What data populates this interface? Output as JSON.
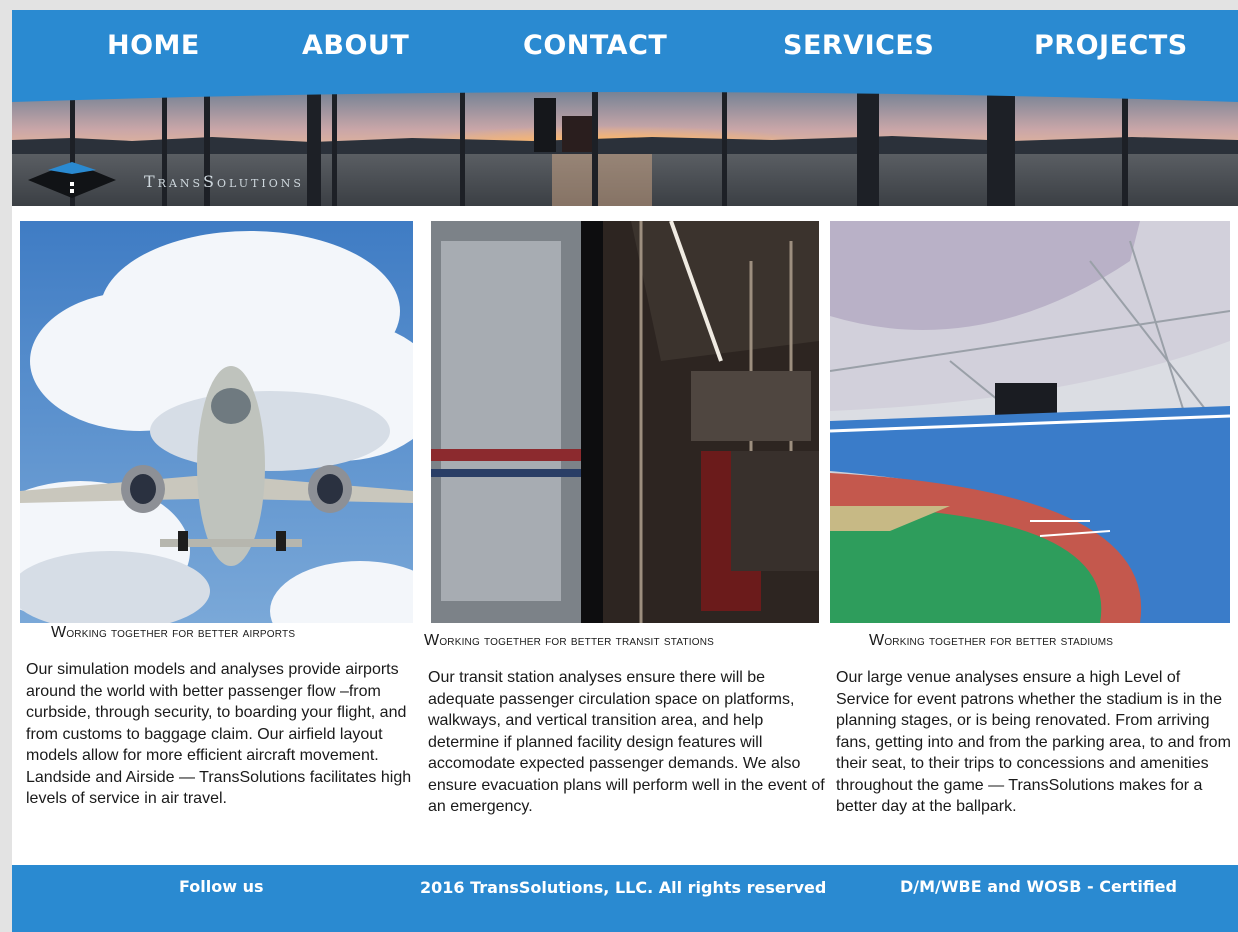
{
  "nav": {
    "items": [
      {
        "label": "HOME"
      },
      {
        "label": "ABOUT"
      },
      {
        "label": "CONTACT"
      },
      {
        "label": "SERVICES"
      },
      {
        "label": "PROJECTS"
      }
    ]
  },
  "banner": {
    "logo_text": "TransSolutions"
  },
  "columns": [
    {
      "photo": "airplane-in-clouds",
      "caption": "Working together for better airports",
      "text": "Our simulation models and analyses provide airports around the world with better passenger flow –from curbside, through security, to boarding your flight, and from customs to baggage claim. Our airfield layout models allow for more efficient aircraft movement. Landside and Airside — TransSolutions facilitates high levels of service in air travel."
    },
    {
      "photo": "transit-train-interior",
      "caption": "Working together for better transit stations",
      "text": "Our transit station analyses ensure there will be adequate passenger circulation space on platforms, walkways, and vertical transition area, and help determine if planned facility design features will accomodate expected passenger demands. We also ensure evacuation plans will perform well in the event of an emergency."
    },
    {
      "photo": "empty-stadium",
      "caption": "Working together for better stadiums",
      "text": "Our large venue analyses ensure a high Level of Service for event patrons whether the stadium is in the planning stages, or is being renovated. From arriving fans, getting into and from the parking area, to and from their seat, to their trips to concessions and amenities throughout the game — TransSolutions makes for a better day at the ballpark."
    }
  ],
  "footer": {
    "follow": "Follow us",
    "copyright": "2016 TransSolutions, LLC. All rights reserved",
    "certified": "D/M/WBE and WOSB - Certified"
  },
  "colors": {
    "brand_blue": "#2a8ad1"
  }
}
